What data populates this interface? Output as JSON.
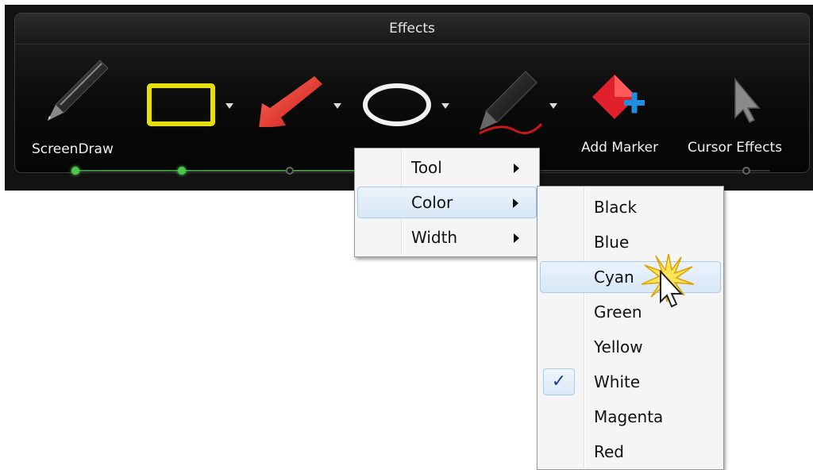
{
  "ribbon": {
    "group_title": "Effects",
    "tools": [
      {
        "name": "ScreenDraw",
        "icon": "pen-icon"
      },
      {
        "name": "",
        "icon": "rectangle-icon"
      },
      {
        "name": "",
        "icon": "arrow-icon"
      },
      {
        "name": "",
        "icon": "ellipse-icon"
      },
      {
        "name": "",
        "icon": "highlighter-pen-icon"
      },
      {
        "name": "Add Marker",
        "icon": "add-marker-icon"
      },
      {
        "name": "Cursor Effects",
        "icon": "cursor-effects-icon"
      }
    ]
  },
  "context_menu": {
    "items": [
      {
        "label": "Tool",
        "has_submenu": true
      },
      {
        "label": "Color",
        "has_submenu": true,
        "highlighted": true
      },
      {
        "label": "Width",
        "has_submenu": true
      }
    ]
  },
  "color_submenu": {
    "items": [
      {
        "label": "Black"
      },
      {
        "label": "Blue"
      },
      {
        "label": "Cyan",
        "hovered": true
      },
      {
        "label": "Green"
      },
      {
        "label": "Yellow"
      },
      {
        "label": "White",
        "checked": true
      },
      {
        "label": "Magenta"
      },
      {
        "label": "Red"
      }
    ],
    "check_glyph": "✓"
  },
  "colors": {
    "ribbon_bg": "#121212",
    "highlight_border": "#a8cbe9",
    "rectangle_stroke": "#e8e000",
    "arrow_fill": "#e8302a",
    "marker_red": "#e0202a",
    "marker_plus": "#1e8fe0",
    "check": "#1b3f8c"
  }
}
